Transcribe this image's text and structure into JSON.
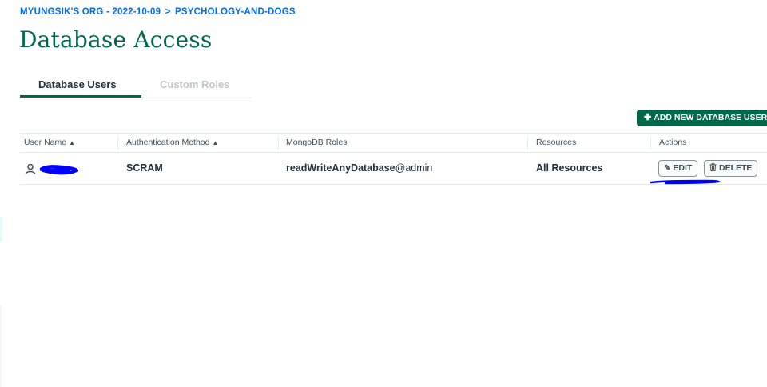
{
  "breadcrumb": {
    "org": "MYUNGSIK'S ORG - 2022-10-09",
    "separator": ">",
    "project": "PSYCHOLOGY-AND-DOGS"
  },
  "page": {
    "title": "Database Access"
  },
  "tabs": [
    {
      "label": "Database Users",
      "active": true
    },
    {
      "label": "Custom Roles",
      "active": false
    }
  ],
  "toolbar": {
    "add_user_label": "ADD NEW DATABASE USER"
  },
  "table": {
    "columns": [
      "User Name",
      "Authentication Method",
      "MongoDB Roles",
      "Resources",
      "Actions"
    ],
    "rows": [
      {
        "user_name": "",
        "auth_method": "SCRAM",
        "role": "readWriteAnyDatabase",
        "role_db": "@admin",
        "resources": "All Resources",
        "edit_label": "EDIT",
        "delete_label": "DELETE"
      }
    ]
  },
  "colors": {
    "accent_green": "#00684a",
    "link_blue": "#016bf8",
    "scribble_blue": "#0000ff"
  },
  "icons": [
    "sort-icon",
    "sort-asc-icon",
    "user-icon",
    "pencil-icon",
    "trash-icon",
    "plus-icon"
  ]
}
